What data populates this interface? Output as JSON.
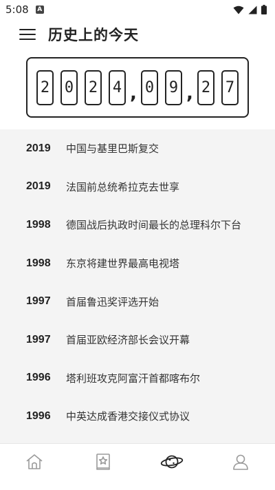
{
  "status_bar": {
    "time": "5:08",
    "notification_badge": "A",
    "icons": [
      "wifi-icon",
      "signal-icon",
      "battery-icon"
    ]
  },
  "header": {
    "menu_icon": "menu-icon",
    "title": "历史上的今天"
  },
  "date_display": {
    "year_digits": [
      "2",
      "0",
      "2",
      "4"
    ],
    "separator": ",",
    "month_digits": [
      "0",
      "9"
    ],
    "day_digits": [
      "2",
      "7"
    ]
  },
  "events": [
    {
      "year": "2019",
      "text": "中国与基里巴斯复交"
    },
    {
      "year": "2019",
      "text": "法国前总统希拉克去世享"
    },
    {
      "year": "1998",
      "text": "德国战后执政时间最长的总理科尔下台"
    },
    {
      "year": "1998",
      "text": "东京将建世界最高电视塔"
    },
    {
      "year": "1997",
      "text": "首届鲁迅奖评选开始"
    },
    {
      "year": "1997",
      "text": "首届亚欧经济部长会议开幕"
    },
    {
      "year": "1996",
      "text": "塔利班攻克阿富汗首都喀布尔"
    },
    {
      "year": "1996",
      "text": "中英达成香港交接仪式协议"
    }
  ],
  "bottom_nav": {
    "items": [
      "home-icon",
      "starred-book-icon",
      "planet-icon",
      "profile-icon"
    ],
    "active": "planet-icon"
  },
  "colors": {
    "text": "#222222",
    "list_background": "#f4f4f4",
    "nav_inactive": "#9a9a9a"
  }
}
